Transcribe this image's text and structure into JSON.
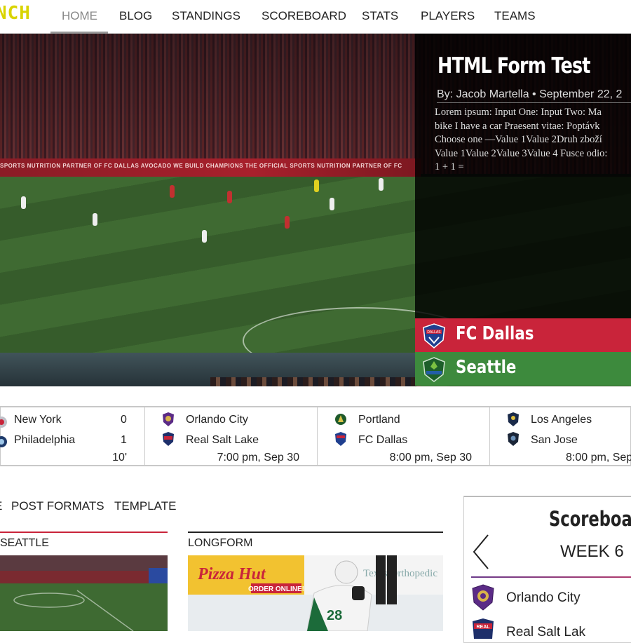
{
  "nav": {
    "logo": "NCH",
    "items": [
      "HOME",
      "BLOG",
      "STANDINGS",
      "SCOREBOARD",
      "STATS",
      "PLAYERS",
      "TEAMS"
    ],
    "active": "HOME"
  },
  "hero": {
    "ad_text": "SPORTS NUTRITION PARTNER OF FC DALLAS    AVOCADO    WE BUILD CHAMPIONS    THE OFFICIAL SPORTS NUTRITION PARTNER OF FC",
    "article": {
      "title": "HTML Form Test",
      "byline": "By: Jacob Martella • September 22, 2",
      "body_lines": [
        "Lorem ipsum: Input One: Input Two: Ma",
        "bike I have a car Praesent vitae: Poptávk",
        "Choose one —Value 1Value 2Druh zboží",
        "Value 1Value 2Value 3Value 4 Fusce odio:",
        "1 + 1 ="
      ]
    },
    "match": {
      "home": "FC Dallas",
      "away": "Seattle",
      "home_color": "#c9243a",
      "away_color": "#3d8a3d"
    }
  },
  "ticker": {
    "games": [
      {
        "team1": "New York",
        "team2": "Philadelphia",
        "score1": "0",
        "score2": "1",
        "time": "10'"
      },
      {
        "team1": "Orlando City",
        "team2": "Real Salt Lake",
        "time": "7:00 pm, Sep 30"
      },
      {
        "team1": "Portland",
        "team2": "FC Dallas",
        "time": "8:00 pm, Sep 30"
      },
      {
        "team1": "Los Angeles",
        "team2": "San Jose",
        "time": "8:00 pm, Sep"
      }
    ]
  },
  "tabs": [
    "E",
    "POST FORMATS",
    "TEMPLATE"
  ],
  "cards": [
    {
      "label": "SEATTLE",
      "rule_color": "#c9243a"
    },
    {
      "label": "LONGFORM",
      "rule_color": "#222222"
    }
  ],
  "card_img_text": {
    "pizza": "Pizza Hut",
    "order": "ORDER ONLINE!",
    "jersey": "28",
    "ortho": "Texas Orthopedic"
  },
  "scoreboard": {
    "title": "Scoreboard",
    "week": "WEEK 6",
    "teams": [
      "Orlando City",
      "Real Salt Lak"
    ]
  }
}
